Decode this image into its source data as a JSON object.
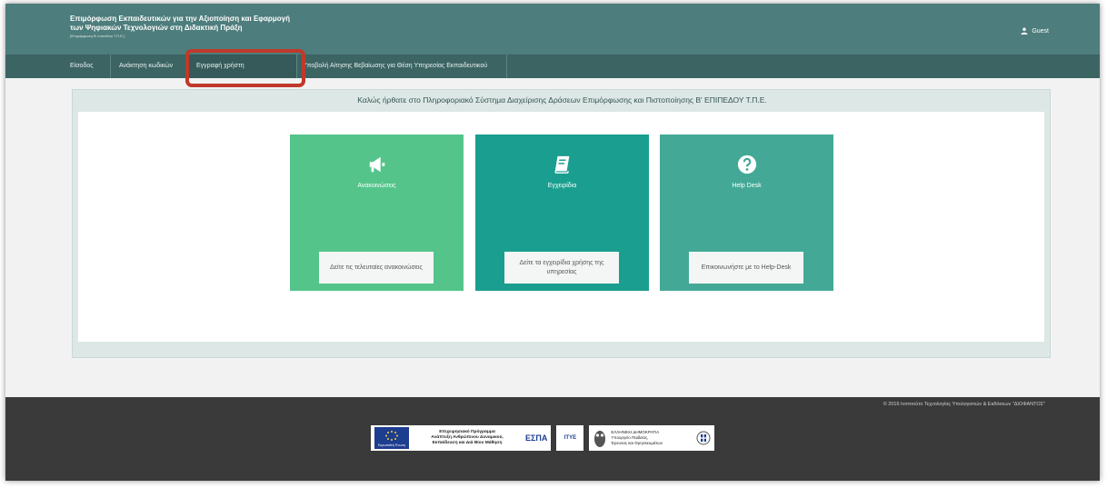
{
  "header": {
    "title_line1": "Επιμόρφωση Εκπαιδευτικών για την Αξιοποίηση και Εφαρμογή",
    "title_line2": "των Ψηφιακών Τεχνολογιών στη Διδακτική Πράξη",
    "title_line3": "(Επιμόρφωση Β' επιπέδου Τ.Π.Ε.)",
    "user_label": "Guest",
    "user_icon": "user-icon"
  },
  "nav": {
    "items": [
      {
        "label": "Είσοδος"
      },
      {
        "label": "Ανάκτηση κωδικών"
      },
      {
        "label": "Εγγραφή χρήστη"
      },
      {
        "label": "Υποβολή Αίτησης Βεβαίωσης για Θέση Υπηρεσίας Εκπαιδευτικού"
      }
    ]
  },
  "welcome": "Καλώς ήρθατε στο Πληροφοριακό Σύστημα Διαχείρισης Δράσεων Επιμόρφωσης και Πιστοποίησης Β' ΕΠΙΠΕΔΟΥ Τ.Π.Ε.",
  "cards": [
    {
      "title": "Ανακοινώσεις",
      "button": "Δείτε τις τελευταίες ανακοινώσεις",
      "icon": "megaphone-icon",
      "color": "#54c48b"
    },
    {
      "title": "Εγχειρίδια",
      "button": "Δείτε τα εγχειρίδια χρήσης της υπηρεσίας",
      "icon": "book-icon",
      "color": "#1a9e8f"
    },
    {
      "title": "Help Desk",
      "button": "Επικοινωνήστε με το Help-Desk",
      "icon": "question-circle-icon",
      "color": "#43a996"
    }
  ],
  "footer": {
    "copyright": "© 2016 Ινστιτούτο Τεχνολογίας Υπολογιστών & Εκδόσεων \"ΔΙΟΦΑΝΤΟΣ\"",
    "logo1_eu": "Ευρωπαϊκή Ένωση",
    "logo1_text1": "Επιχειρησιακό Πρόγραμμα",
    "logo1_text2": "Ανάπτυξη Ανθρώπινου Δυναμικού,",
    "logo1_text3": "Εκπαίδευση και Διά Βίου Μάθηση",
    "logo1_espa": "ΕΣΠΑ",
    "logo2": "ΙΤΥΕ",
    "logo3_line1": "ΕΛΛΗΝΙΚΗ ΔΗΜΟΚΡΑΤΙΑ",
    "logo3_line2": "Υπουργείο Παιδείας,",
    "logo3_line3": "Έρευνας και Θρησκευμάτων"
  },
  "colors": {
    "header": "#4d7d7c",
    "nav": "#3c6463",
    "highlight": "#c0392b",
    "footer": "#3a3a3a"
  }
}
